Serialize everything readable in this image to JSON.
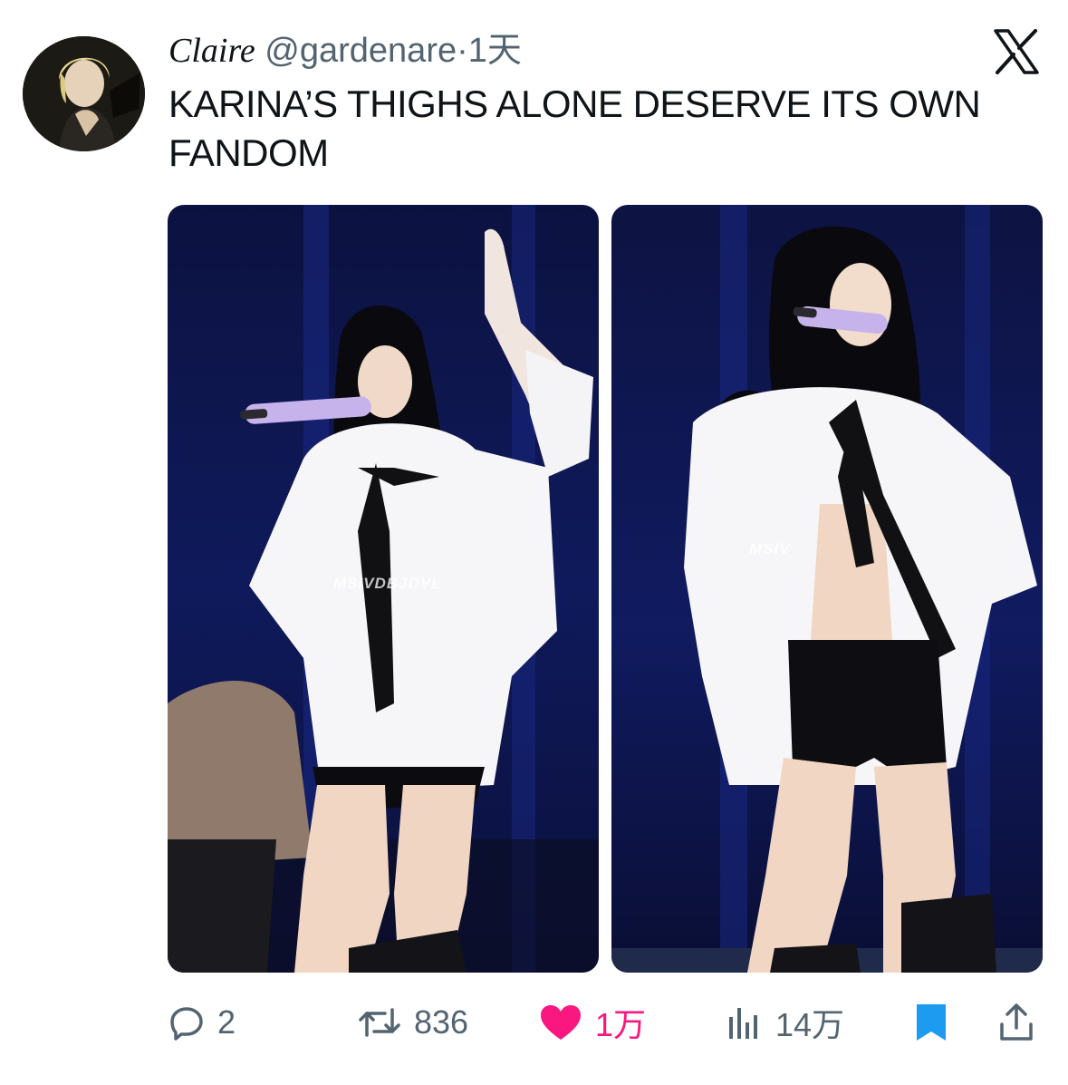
{
  "post": {
    "author_name": "Claire",
    "author_handle": "@gardenare",
    "separator": "·",
    "time": "1天",
    "text": "KARINA’S THIGHS ALONE DESERVE ITS OWN FANDOM"
  },
  "media": [
    {
      "watermark": "MSIVDBJDVL"
    },
    {
      "watermark": "MSIV"
    }
  ],
  "actions": {
    "replies": "2",
    "reposts": "836",
    "likes": "1万",
    "views": "14万"
  },
  "colors": {
    "like": "#f91880",
    "bookmark": "#1d9bf0",
    "muted": "#536471",
    "text": "#0f1419"
  },
  "icons": [
    "x-logo-icon",
    "reply-icon",
    "repost-icon",
    "heart-icon",
    "views-icon",
    "bookmark-icon",
    "share-icon"
  ]
}
